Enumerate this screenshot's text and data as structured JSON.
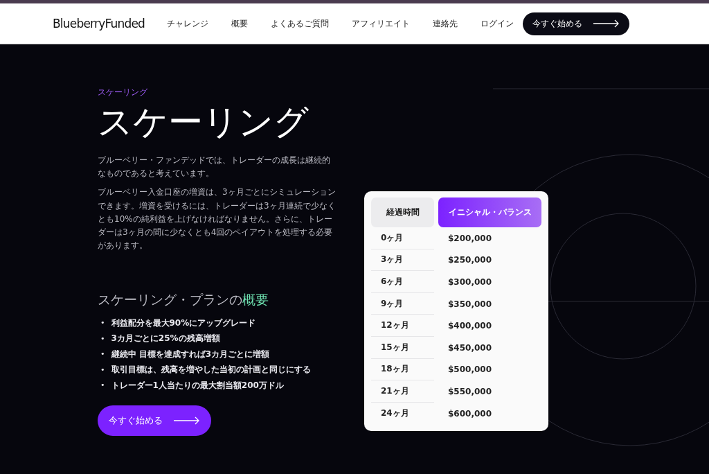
{
  "header": {
    "logo": "BlueberryFunded",
    "nav": [
      {
        "label": "チャレンジ"
      },
      {
        "label": "概要"
      },
      {
        "label": "よくあるご質問"
      },
      {
        "label": "アフィリエイト"
      },
      {
        "label": "連絡先"
      },
      {
        "label": "ログイン"
      }
    ],
    "cta": "今すぐ始める"
  },
  "hero": {
    "eyebrow": "スケーリング",
    "title": "スケーリング",
    "paragraphs": [
      "ブルーベリー・ファンデッドでは、トレーダーの成長は継続的なものであると考えています。",
      "ブルーベリー入金口座の増資は、3ヶ月ごとにシミュレーションできます。増資を受けるには、トレーダーは3ヶ月連続で少なくとも10%の純利益を上げなければなりません。さらに、トレーダーは3ヶ月の間に少なくとも4回のペイアウトを処理する必要があります。"
    ]
  },
  "overview": {
    "title": "スケーリング・プランの",
    "title_highlight": "概要",
    "bullet": "•",
    "items": [
      "利益配分を最大90%にアップグレード",
      "3カ月ごとに25%の残高増額",
      "継続中 目標を達成すれば3カ月ごとに増額",
      "取引目標は、残高を増やした当初の計画と同じにする",
      "トレーダー1人当たりの最大割当額200万ドル"
    ],
    "cta": "今すぐ始める"
  },
  "table": {
    "columns": [
      "経過時間",
      "イニシャル・バランス"
    ],
    "rows": [
      [
        "0ヶ月",
        "$200,000"
      ],
      [
        "3ヶ月",
        "$250,000"
      ],
      [
        "6ヶ月",
        "$300,000"
      ],
      [
        "9ヶ月",
        "$350,000"
      ],
      [
        "12ヶ月",
        "$400,000"
      ],
      [
        "15ヶ月",
        "$450,000"
      ],
      [
        "18ヶ月",
        "$500,000"
      ],
      [
        "21ヶ月",
        "$550,000"
      ],
      [
        "24ヶ月",
        "$600,000"
      ]
    ]
  }
}
